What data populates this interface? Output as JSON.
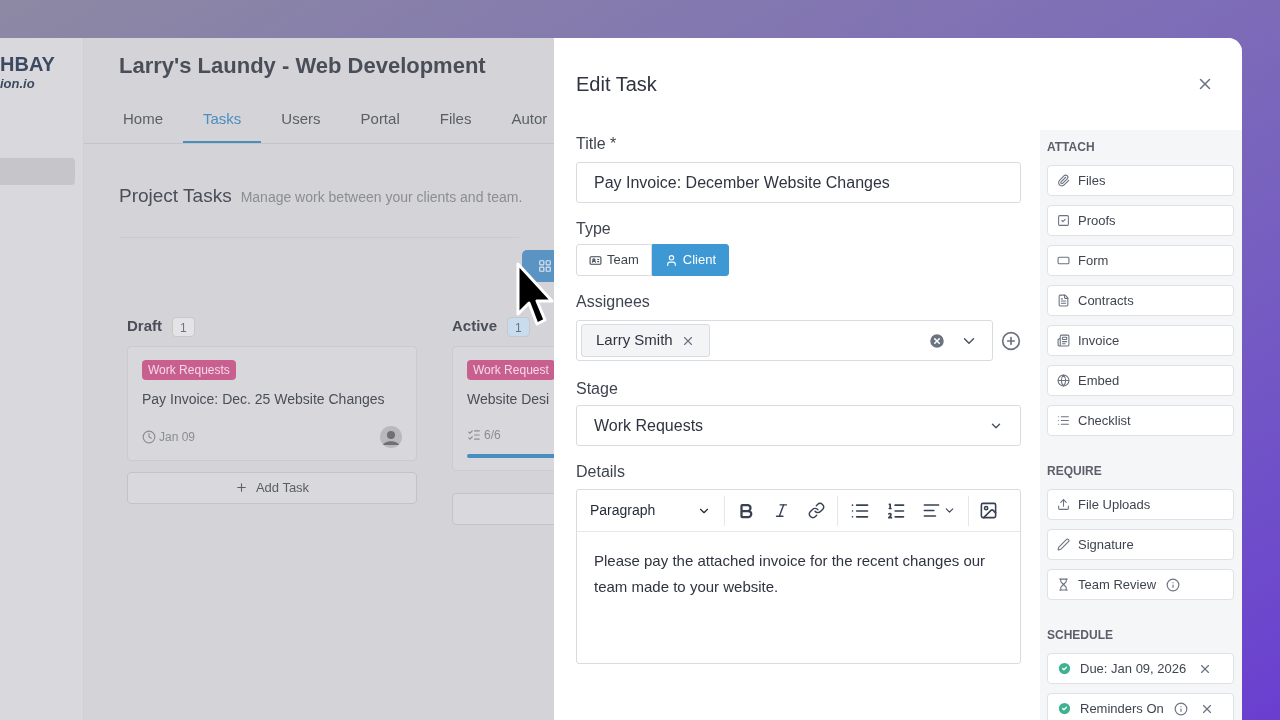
{
  "app": {
    "logo_name": "HBAY",
    "logo_domain": "ion.io",
    "project_title": "Larry's Laundy - Web Development",
    "tabs": [
      {
        "label": "Home",
        "selected": false
      },
      {
        "label": "Tasks",
        "selected": true
      },
      {
        "label": "Users",
        "selected": false
      },
      {
        "label": "Portal",
        "selected": false
      },
      {
        "label": "Files",
        "selected": false
      },
      {
        "label": "Autor",
        "selected": false
      }
    ],
    "section_title": "Project Tasks",
    "section_subtitle": "Manage work between your clients and team.",
    "columns": [
      {
        "name": "Draft",
        "count": "1",
        "color": "#e4e4e7",
        "cards": [
          {
            "tag": "Work Requests",
            "title": "Pay Invoice: Dec. 25 Website Changes",
            "meta": {
              "kind": "due",
              "text": "Jan 09"
            },
            "avatar": true
          }
        ],
        "add_label": "Add Task"
      },
      {
        "name": "Active",
        "count": "1",
        "color": "#c7dcec",
        "cards": [
          {
            "tag": "Work Request",
            "title": "Website Desi",
            "meta": {
              "kind": "checklist",
              "text": "6/6"
            },
            "avatar": false,
            "progress": {
              "level": 1
            }
          }
        ]
      }
    ]
  },
  "modal": {
    "title": "Edit Task",
    "title_field": {
      "label": "Title *",
      "value": "Pay Invoice: December Website Changes"
    },
    "type_field": {
      "label": "Type",
      "options": [
        {
          "label": "Team",
          "kind": "team",
          "selected": false
        },
        {
          "label": "Client",
          "kind": "client",
          "selected": true
        }
      ]
    },
    "assignees": {
      "label": "Assignees",
      "chips": [
        "Larry Smith"
      ]
    },
    "stage": {
      "label": "Stage",
      "value": "Work Requests"
    },
    "details": {
      "label": "Details",
      "block_format": "Paragraph",
      "text": "Please pay the attached invoice for the recent changes our team made to your website."
    },
    "sidebar": [
      {
        "heading": "ATTACH",
        "items": [
          {
            "label": "Files",
            "kind": "files"
          },
          {
            "label": "Proofs",
            "kind": "proofs"
          },
          {
            "label": "Form",
            "kind": "form"
          },
          {
            "label": "Contracts",
            "kind": "contracts"
          },
          {
            "label": "Invoice",
            "kind": "invoice"
          },
          {
            "label": "Embed",
            "kind": "embed"
          },
          {
            "label": "Checklist",
            "kind": "checklist"
          }
        ]
      },
      {
        "heading": "REQUIRE",
        "items": [
          {
            "label": "File Uploads",
            "kind": "upload"
          },
          {
            "label": "Signature",
            "kind": "signature"
          },
          {
            "label": "Team Review",
            "kind": "review",
            "info": true
          }
        ]
      },
      {
        "heading": "SCHEDULE",
        "items": [
          {
            "label": "Due: Jan 09, 2026",
            "kind": "schedule",
            "checked": true,
            "removable": true
          },
          {
            "label": "Reminders On",
            "kind": "schedule",
            "checked": true,
            "info": true,
            "removable": true
          }
        ]
      }
    ]
  }
}
